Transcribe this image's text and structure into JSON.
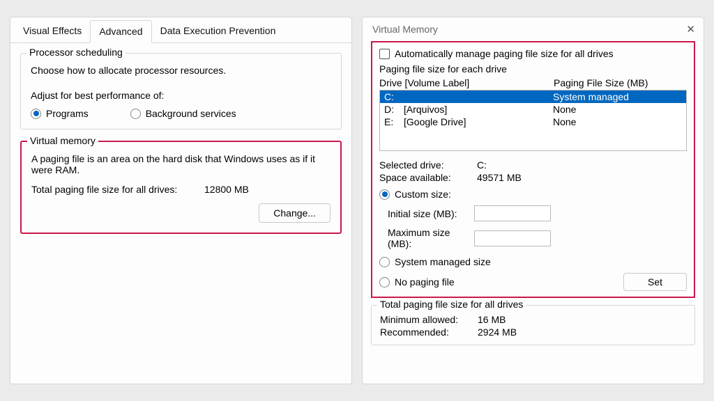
{
  "left": {
    "tabs": {
      "visual": "Visual Effects",
      "advanced": "Advanced",
      "dep": "Data Execution Prevention"
    },
    "proc": {
      "title": "Processor scheduling",
      "desc": "Choose how to allocate processor resources.",
      "adjust": "Adjust for best performance of:",
      "programs": "Programs",
      "background": "Background services"
    },
    "vm": {
      "title": "Virtual memory",
      "desc": "A paging file is an area on the hard disk that Windows uses as if it were RAM.",
      "totalLabel": "Total paging file size for all drives:",
      "totalValue": "12800 MB",
      "change": "Change..."
    }
  },
  "right": {
    "title": "Virtual Memory",
    "auto": "Automatically manage paging file size for all drives",
    "eachLabel": "Paging file size for each drive",
    "colDrive": "Drive  [Volume Label]",
    "colSize": "Paging File Size (MB)",
    "drives": [
      {
        "letter": "C:",
        "label": "",
        "size": "System managed",
        "selected": true
      },
      {
        "letter": "D:",
        "label": "[Arquivos]",
        "size": "None",
        "selected": false
      },
      {
        "letter": "E:",
        "label": "[Google Drive]",
        "size": "None",
        "selected": false
      }
    ],
    "selectedDriveLabel": "Selected drive:",
    "selectedDrive": "C:",
    "spaceLabel": "Space available:",
    "space": "49571 MB",
    "custom": "Custom size:",
    "initial": "Initial size (MB):",
    "maximum": "Maximum size (MB):",
    "sysManaged": "System managed size",
    "noPaging": "No paging file",
    "set": "Set",
    "totalsTitle": "Total paging file size for all drives",
    "minAllowedLabel": "Minimum allowed:",
    "minAllowed": "16 MB",
    "recommendedLabel": "Recommended:",
    "recommended": "2924 MB"
  }
}
